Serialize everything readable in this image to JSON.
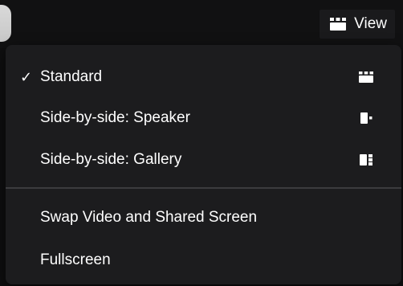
{
  "toolbar": {
    "view_label": "View",
    "view_icon": "gallery-grid-icon"
  },
  "menu": {
    "items": [
      {
        "label": "Standard",
        "checked": true,
        "icon": "standard-layout-icon"
      },
      {
        "label": "Side-by-side: Speaker",
        "checked": false,
        "icon": "side-by-side-speaker-icon"
      },
      {
        "label": "Side-by-side: Gallery",
        "checked": false,
        "icon": "side-by-side-gallery-icon"
      },
      {
        "label": "Swap Video and Shared Screen",
        "checked": false
      },
      {
        "label": "Fullscreen",
        "checked": false
      }
    ],
    "check_glyph": "✓"
  },
  "colors": {
    "menu_background": "#1c1c1e",
    "text": "#ffffff",
    "divider": "#3b3b3e"
  }
}
